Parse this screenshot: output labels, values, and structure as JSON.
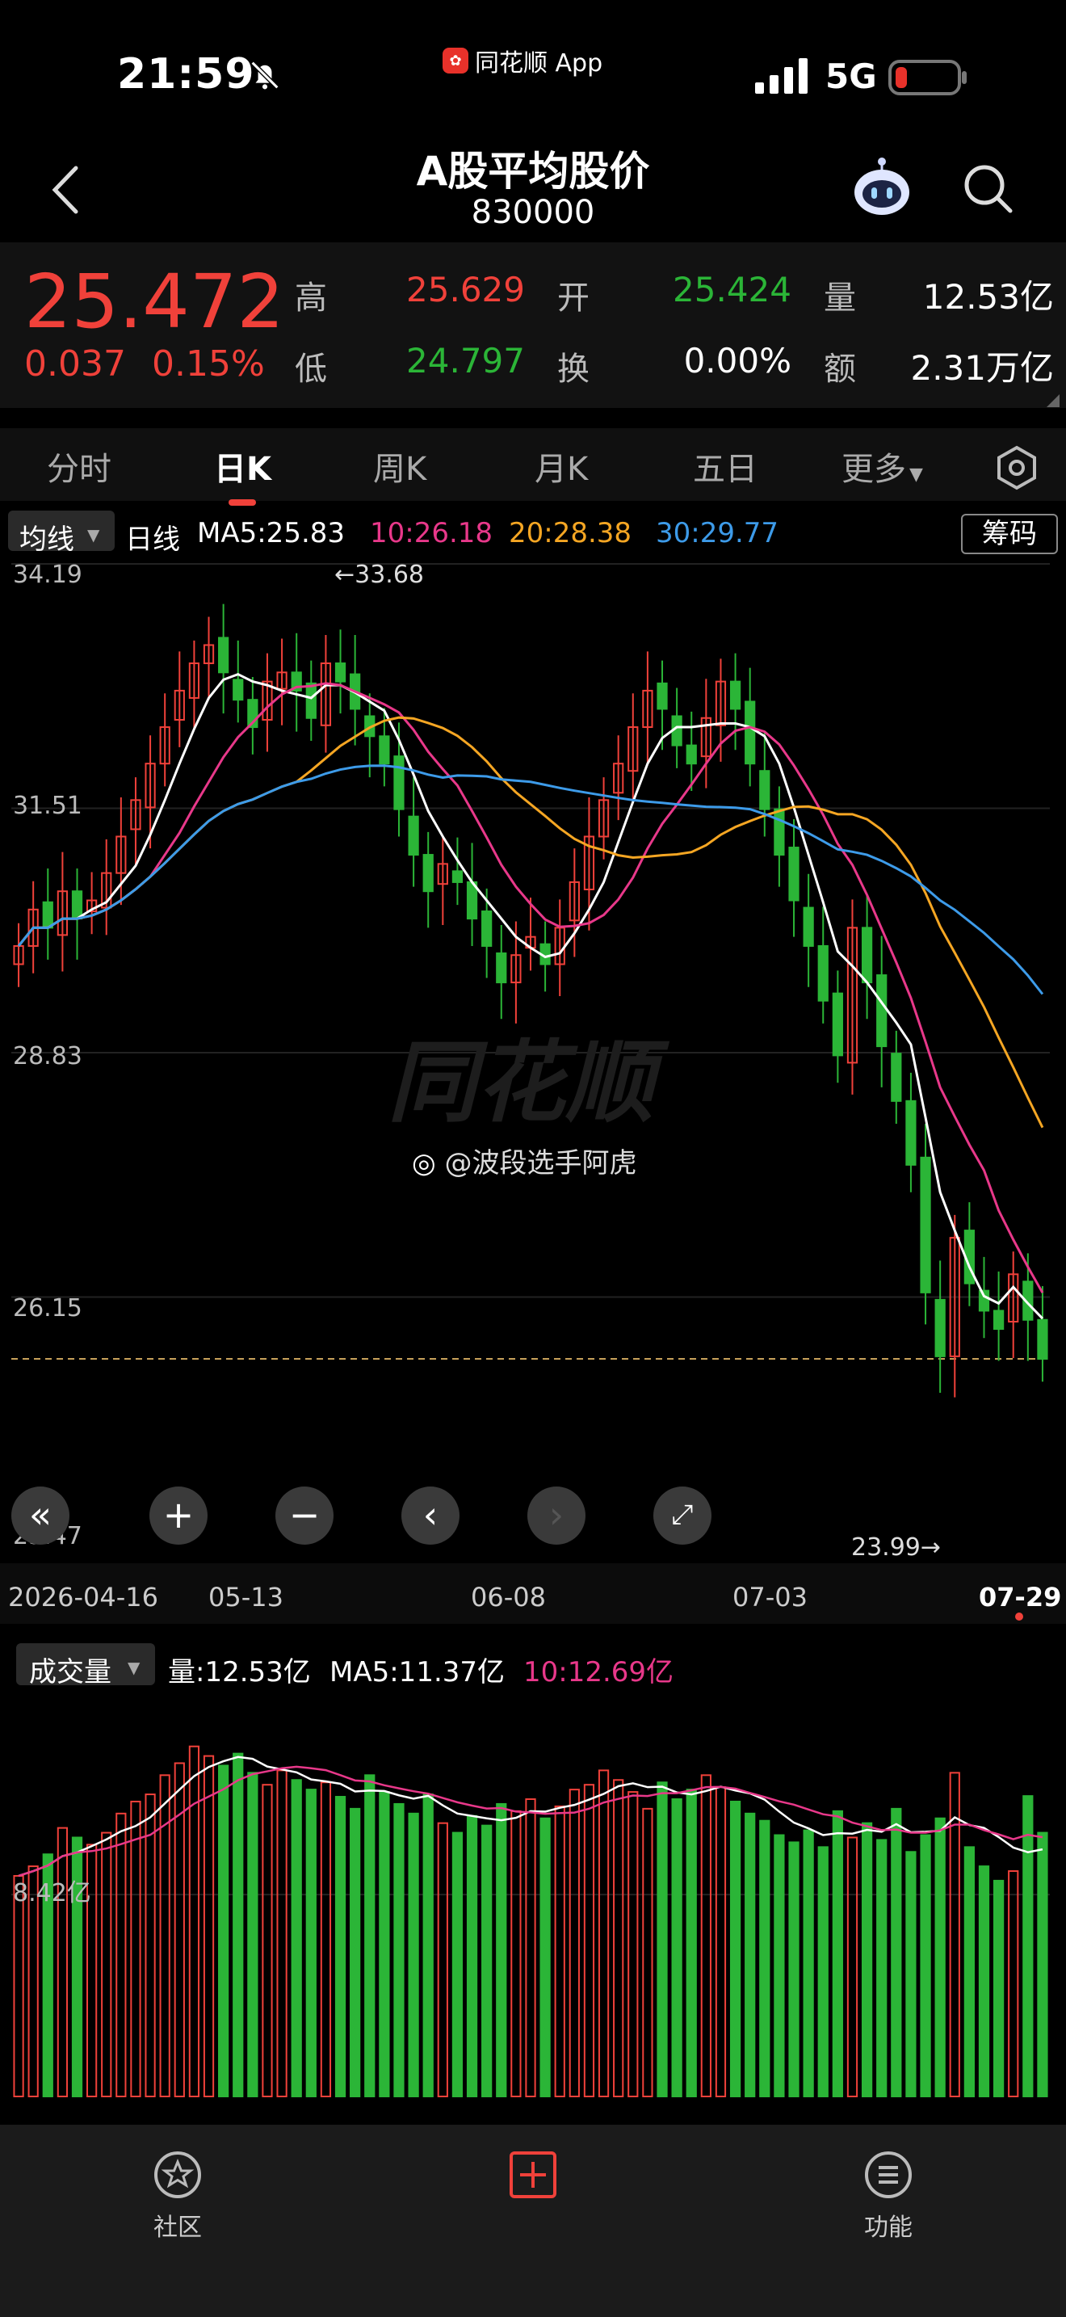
{
  "status": {
    "time": "21:59",
    "app_name": "同花顺 App",
    "network": "5G"
  },
  "header": {
    "title": "A股平均股价",
    "code": "830000"
  },
  "quote": {
    "price": "25.472",
    "change": "0.037",
    "change_pct": "0.15%",
    "high_label": "高",
    "high": "25.629",
    "open_label": "开",
    "open": "25.424",
    "volume_label": "量",
    "volume": "12.53亿",
    "low_label": "低",
    "low": "24.797",
    "turnover_label": "换",
    "turnover": "0.00%",
    "amount_label": "额",
    "amount": "2.31万亿"
  },
  "tabs": [
    "分时",
    "日K",
    "周K",
    "月K",
    "五日",
    "更多"
  ],
  "active_tab": "日K",
  "indicators": {
    "ma_select": "均线",
    "period": "日线",
    "ma5": "MA5:25.83",
    "ma10": "10:26.18",
    "ma20": "20:28.38",
    "ma30": "30:29.77",
    "chip_button": "筹码"
  },
  "chart": {
    "y_labels": [
      "34.19",
      "31.51",
      "28.83",
      "26.15",
      "23.47"
    ],
    "max_annotation": "←33.68",
    "min_annotation": "23.99→",
    "date_labels": [
      "2026-04-16",
      "05-13",
      "06-08",
      "07-03",
      "07-29"
    ],
    "watermark": "同花顺",
    "credit": "@波段选手阿虎",
    "colors": {
      "up": "#f0413a",
      "down": "#2bb537",
      "ma5": "#ffffff",
      "ma10": "#e8388a",
      "ma20": "#f5a623",
      "ma30": "#3d9be9"
    }
  },
  "volume": {
    "select": "成交量",
    "vol": "量:12.53亿",
    "ma5": "MA5:11.37亿",
    "ma10": "10:12.69亿",
    "axis_label": "8.42亿"
  },
  "bottom_nav": {
    "community": "社区",
    "function": "功能"
  },
  "chart_data": {
    "type": "candlestick",
    "ylim": [
      23.47,
      34.19
    ],
    "x": [
      "2026-04-16",
      "05-13",
      "06-08",
      "07-03",
      "07-29"
    ],
    "series": [
      {
        "name": "MA5",
        "values": [
          25.83
        ]
      },
      {
        "name": "10",
        "values": [
          26.18
        ]
      },
      {
        "name": "20",
        "values": [
          28.38
        ]
      },
      {
        "name": "30",
        "values": [
          29.77
        ]
      }
    ],
    "close": [
      30.0,
      30.4,
      30.2,
      30.6,
      30.3,
      30.5,
      30.8,
      31.2,
      31.6,
      32.0,
      32.4,
      32.8,
      33.1,
      33.3,
      33.0,
      32.7,
      32.4,
      32.9,
      33.0,
      32.8,
      32.5,
      33.1,
      32.9,
      32.6,
      32.3,
      32.0,
      31.5,
      31.0,
      30.6,
      30.9,
      30.7,
      30.3,
      30.0,
      29.6,
      29.9,
      30.1,
      29.8,
      30.2,
      30.7,
      31.2,
      31.6,
      32.0,
      32.4,
      32.8,
      32.6,
      32.2,
      32.0,
      32.5,
      32.9,
      32.6,
      32.0,
      31.5,
      31.0,
      30.5,
      30.0,
      29.4,
      28.8,
      30.2,
      29.6,
      28.9,
      28.3,
      27.6,
      26.2,
      25.5,
      26.8,
      26.3,
      26.0,
      25.8,
      26.4,
      25.9,
      25.472
    ],
    "volume": [
      9.2,
      9.6,
      10.1,
      11.2,
      10.8,
      10.5,
      11.0,
      11.8,
      12.3,
      12.6,
      13.4,
      13.9,
      14.6,
      14.2,
      13.8,
      14.3,
      13.5,
      13.0,
      13.6,
      13.2,
      12.8,
      13.1,
      12.5,
      12.0,
      13.4,
      12.7,
      12.2,
      11.8,
      12.6,
      11.4,
      11.0,
      11.7,
      11.3,
      12.2,
      11.9,
      12.4,
      11.6,
      12.1,
      12.8,
      13.0,
      13.6,
      13.2,
      12.7,
      12.0,
      13.1,
      12.4,
      12.8,
      13.4,
      12.9,
      12.3,
      11.8,
      11.5,
      10.9,
      10.6,
      11.1,
      10.4,
      11.9,
      10.8,
      11.4,
      10.7,
      12.0,
      10.2,
      10.9,
      11.6,
      13.5,
      10.4,
      9.6,
      9.0,
      9.4,
      12.53,
      11.0
    ]
  }
}
